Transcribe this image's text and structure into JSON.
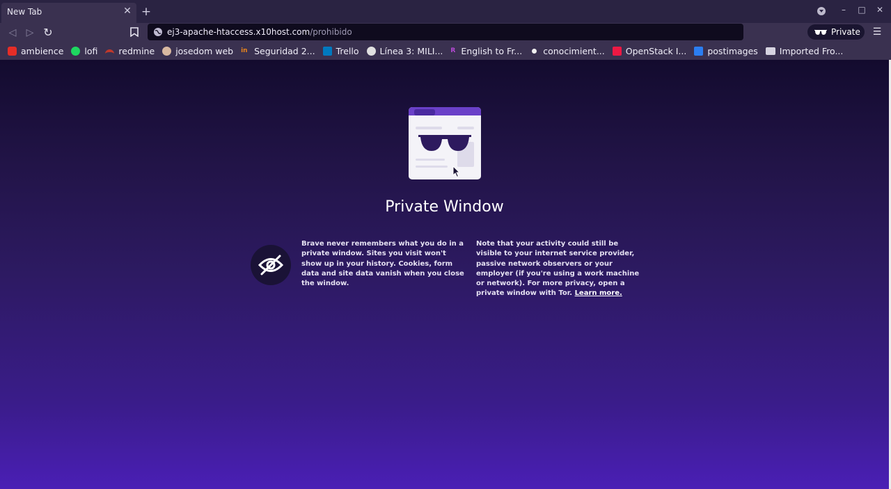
{
  "tab": {
    "title": "New Tab"
  },
  "url": {
    "host": "ej3-apache-htaccess.x10host.com",
    "path": "/prohibido"
  },
  "private_badge": "Private",
  "bookmarks": [
    {
      "label": "ambience",
      "icon": "youtube-icon",
      "color": "#e52d27"
    },
    {
      "label": "lofi",
      "icon": "spotify-icon",
      "color": "#1ed760"
    },
    {
      "label": "redmine",
      "icon": "redmine-icon",
      "color": "#c0392b"
    },
    {
      "label": "josedom web",
      "icon": "avatar-icon",
      "color": "#d8b8a0"
    },
    {
      "label": "Seguridad 2...",
      "icon": "in-icon",
      "color": "#e8841c"
    },
    {
      "label": "Trello",
      "icon": "trello-icon",
      "color": "#0079bf"
    },
    {
      "label": "Línea 3: MILI...",
      "icon": "globe-icon",
      "color": "#e0e0e0"
    },
    {
      "label": "English to Fr...",
      "icon": "reverso-icon",
      "color": "#b74ad6"
    },
    {
      "label": "conocimient...",
      "icon": "github-icon",
      "color": "#f0f0f0"
    },
    {
      "label": "OpenStack I...",
      "icon": "openstack-icon",
      "color": "#ed1944"
    },
    {
      "label": "postimages",
      "icon": "postimages-icon",
      "color": "#2b7ef2"
    },
    {
      "label": "Imported Fro...",
      "icon": "folder-icon",
      "color": "#d6d3e0"
    }
  ],
  "page": {
    "title": "Private Window",
    "para1": "Brave never remembers what you do in a private window. Sites you visit won't show up in your history. Cookies, form data and site data vanish when you close the window.",
    "para2": "Note that your activity could still be visible to your internet service provider, passive network observers or your employer (if you're using a work machine or network). For more privacy, open a private window with Tor.",
    "learn_more": "Learn more."
  }
}
